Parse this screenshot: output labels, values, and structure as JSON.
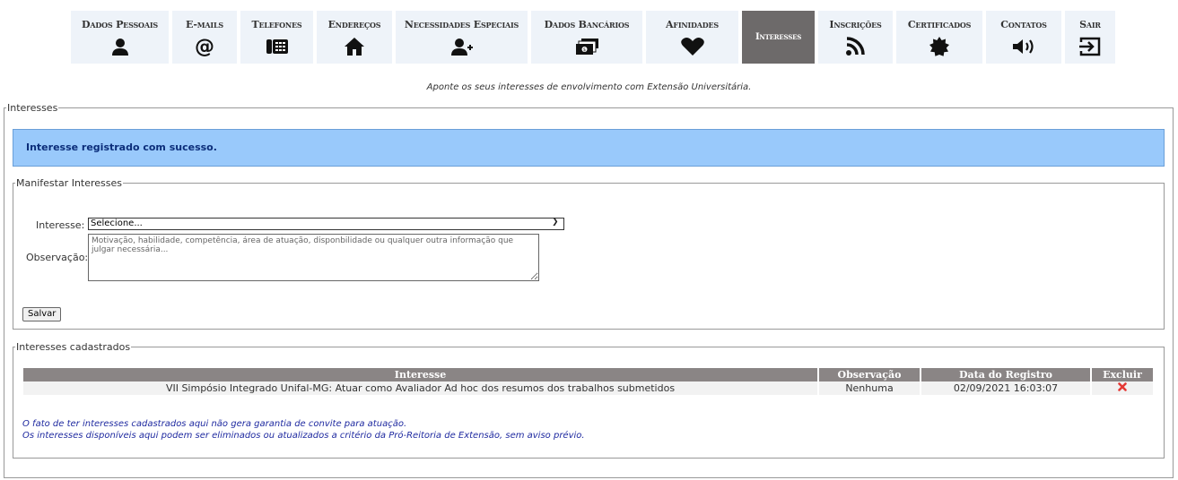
{
  "tabs": [
    {
      "label": "Dados Pessoais",
      "icon": "user-icon",
      "active": false
    },
    {
      "label": "E-mails",
      "icon": "at-icon",
      "active": false
    },
    {
      "label": "Telefones",
      "icon": "phone-icon",
      "active": false
    },
    {
      "label": "Endereços",
      "icon": "home-icon",
      "active": false
    },
    {
      "label": "Necessidades Especiais",
      "icon": "user-plus-icon",
      "active": false
    },
    {
      "label": "Dados Bancários",
      "icon": "money-icon",
      "active": false
    },
    {
      "label": "Afinidades",
      "icon": "heart-icon",
      "active": false
    },
    {
      "label": "Interesses",
      "icon": "",
      "active": true
    },
    {
      "label": "Inscrições",
      "icon": "rss-icon",
      "active": false
    },
    {
      "label": "Certificados",
      "icon": "certificate-icon",
      "active": false
    },
    {
      "label": "Contatos",
      "icon": "volume-icon",
      "active": false
    },
    {
      "label": "Sair",
      "icon": "logout-icon",
      "active": false
    }
  ],
  "intro": "Aponte os seus interesses de envolvimento com Extensão Universitária.",
  "main_legend": "Interesses",
  "alert": "Interesse registrado com sucesso.",
  "form": {
    "legend": "Manifestar Interesses",
    "interest_label": "Interesse:",
    "interest_selected": "Selecione...",
    "obs_label": "Observação:",
    "obs_placeholder": "Motivação, habilidade, competência, área de atuação, disponbilidade ou qualquer outra informação que julgar necessária...",
    "save_label": "Salvar"
  },
  "list": {
    "legend": "Interesses cadastrados",
    "headers": [
      "Interesse",
      "Observação",
      "Data do Registro",
      "Excluir"
    ],
    "rows": [
      {
        "interesse": "VII Simpósio Integrado Unifal-MG: Atuar como Avaliador Ad hoc dos resumos dos trabalhos submetidos",
        "observacao": "Nenhuma",
        "data": "02/09/2021 16:03:07"
      }
    ],
    "notes": [
      "O fato de ter interesses cadastrados aqui não gera garantia de convite para atuação.",
      "Os interesses disponíveis aqui podem ser eliminados ou atualizados a critério da Pró-Reitoria de Extensão, sem aviso prévio."
    ]
  },
  "colors": {
    "active_tab": "#6d6a6a",
    "tab_bg": "#eef3f9",
    "alert_bg": "#99c9fb",
    "table_header": "#8a8585",
    "delete": "#e53935"
  }
}
